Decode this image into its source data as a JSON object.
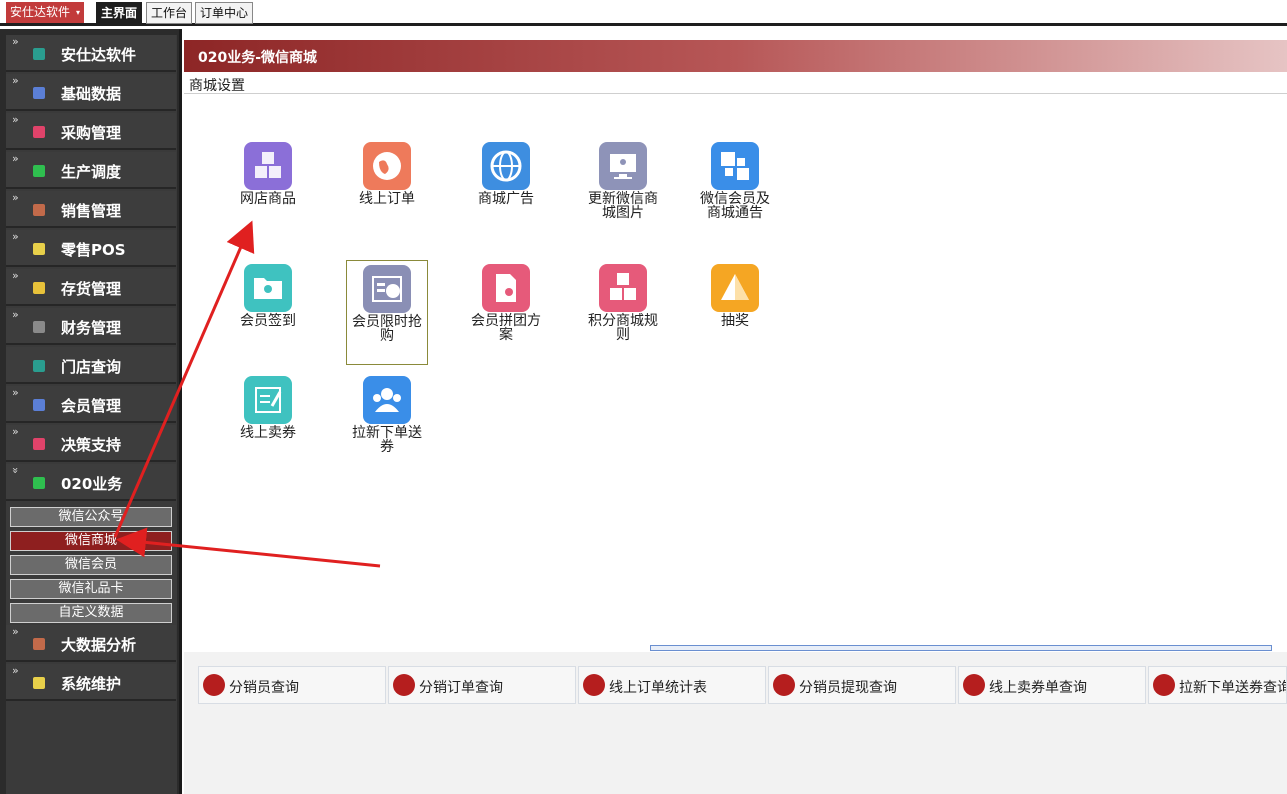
{
  "topbar": {
    "brand": "安仕达软件",
    "tabs": [
      "主界面",
      "工作台",
      "订单中心"
    ]
  },
  "sidebar": {
    "items": [
      {
        "label": "安仕达软件",
        "chev": "»",
        "icon_color": "#2a9d8f"
      },
      {
        "label": "基础数据",
        "chev": "»",
        "icon_color": "#5b7fd6"
      },
      {
        "label": "采购管理",
        "chev": "»",
        "icon_color": "#e0436a"
      },
      {
        "label": "生产调度",
        "chev": "»",
        "icon_color": "#2fbf4f"
      },
      {
        "label": "销售管理",
        "chev": "»",
        "icon_color": "#c26a4a"
      },
      {
        "label": "零售POS",
        "chev": "»",
        "icon_color": "#e8d04a"
      },
      {
        "label": "存货管理",
        "chev": "»",
        "icon_color": "#e8c23a"
      },
      {
        "label": "财务管理",
        "chev": "»",
        "icon_color": "#8a8a8a"
      },
      {
        "label": "门店查询",
        "chev": "",
        "icon_color": "#2a9d8f"
      },
      {
        "label": "会员管理",
        "chev": "»",
        "icon_color": "#5b7fd6"
      },
      {
        "label": "决策支持",
        "chev": "»",
        "icon_color": "#e0436a"
      },
      {
        "label": "020业务",
        "chev": "»",
        "icon_color": "#2fbf4f"
      }
    ],
    "subitems": [
      "微信公众号",
      "微信商城",
      "微信会员",
      "微信礼品卡",
      "自定义数据"
    ],
    "items_after": [
      {
        "label": "大数据分析",
        "chev": "»",
        "icon_color": "#c26a4a"
      },
      {
        "label": "系统维护",
        "chev": "»",
        "icon_color": "#e8d04a"
      }
    ]
  },
  "main": {
    "title": "020业务-微信商城",
    "subtitle": "商城设置",
    "tiles": [
      {
        "label": "网店商品",
        "color": "#8b6fd8",
        "icon": "cubes-icon"
      },
      {
        "label": "线上订单",
        "color": "#ee7a5b",
        "icon": "globe-icon"
      },
      {
        "label": "商城广告",
        "color": "#3e8ee0",
        "icon": "web-globe-icon"
      },
      {
        "label": "更新微信商城图片",
        "color": "#8e93b8",
        "icon": "monitor-icon"
      },
      {
        "label": "微信会员及商城通告",
        "color": "#3a8ee8",
        "icon": "word-doc-icon"
      },
      {
        "label": "会员签到",
        "color": "#3fc2c0",
        "icon": "folder-users-icon"
      },
      {
        "label": "会员限时抢购",
        "color": "#8a8fb5",
        "icon": "timer-icon"
      },
      {
        "label": "会员拼团方案",
        "color": "#e65a7a",
        "icon": "document-user-icon"
      },
      {
        "label": "积分商城规则",
        "color": "#e65a7a",
        "icon": "abc-blocks-icon"
      },
      {
        "label": "抽奖",
        "color": "#f5a623",
        "icon": "pyramid-icon"
      },
      {
        "label": "线上卖券",
        "color": "#3fc2c0",
        "icon": "edit-list-icon"
      },
      {
        "label": "拉新下单送券",
        "color": "#3a8ee8",
        "icon": "users-icon"
      }
    ],
    "quick_buttons": [
      {
        "label": "分销员查询",
        "icon": "search-doc-icon"
      },
      {
        "label": "分销订单查询",
        "icon": "heart-icon"
      },
      {
        "label": "线上订单统计表",
        "icon": "notebook-icon"
      },
      {
        "label": "分销员提现查询",
        "icon": "magnifier-icon"
      },
      {
        "label": "线上卖券单查询",
        "icon": "clipboard-icon"
      },
      {
        "label": "拉新下单送券查询",
        "icon": "x-icon"
      }
    ]
  }
}
